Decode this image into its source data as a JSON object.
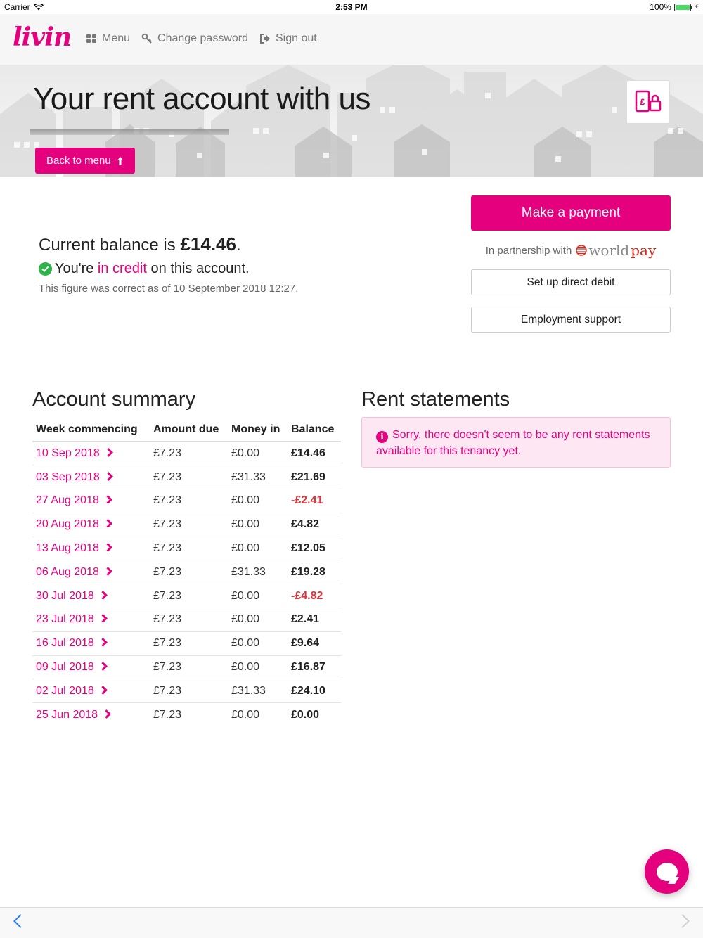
{
  "status_bar": {
    "carrier": "Carrier",
    "time": "2:53 PM",
    "battery": "100%"
  },
  "header": {
    "logo": "livin",
    "nav": [
      {
        "label": "Menu",
        "icon": "grid-icon"
      },
      {
        "label": "Change password",
        "icon": "key-icon"
      },
      {
        "label": "Sign out",
        "icon": "sign-out-icon"
      }
    ]
  },
  "hero": {
    "title": "Your rent account with us",
    "back_label": "Back to menu",
    "icon": "phone-payment-icon"
  },
  "balance": {
    "prefix": "Current balance is ",
    "amount": "£14.46",
    "suffix": ".",
    "status_prefix": "You're ",
    "status_highlight": "in credit",
    "status_suffix": " on this account.",
    "as_of": "This figure was correct as of 10 September 2018 12:27."
  },
  "actions": {
    "make_payment": "Make a payment",
    "partnership_text": "In partnership with",
    "partner_brand_1": "world",
    "partner_brand_2": "pay",
    "direct_debit": "Set up direct debit",
    "employment_support": "Employment support"
  },
  "account_summary": {
    "title": "Account summary",
    "columns": [
      "Week commencing",
      "Amount due",
      "Money in",
      "Balance"
    ],
    "rows": [
      {
        "week": "10 Sep 2018",
        "due": "£7.23",
        "in": "£0.00",
        "balance": "£14.46",
        "negative": false
      },
      {
        "week": "03 Sep 2018",
        "due": "£7.23",
        "in": "£31.33",
        "balance": "£21.69",
        "negative": false
      },
      {
        "week": "27 Aug 2018",
        "due": "£7.23",
        "in": "£0.00",
        "balance": "-£2.41",
        "negative": true
      },
      {
        "week": "20 Aug 2018",
        "due": "£7.23",
        "in": "£0.00",
        "balance": "£4.82",
        "negative": false
      },
      {
        "week": "13 Aug 2018",
        "due": "£7.23",
        "in": "£0.00",
        "balance": "£12.05",
        "negative": false
      },
      {
        "week": "06 Aug 2018",
        "due": "£7.23",
        "in": "£31.33",
        "balance": "£19.28",
        "negative": false
      },
      {
        "week": "30 Jul 2018",
        "due": "£7.23",
        "in": "£0.00",
        "balance": "-£4.82",
        "negative": true
      },
      {
        "week": "23 Jul 2018",
        "due": "£7.23",
        "in": "£0.00",
        "balance": "£2.41",
        "negative": false
      },
      {
        "week": "16 Jul 2018",
        "due": "£7.23",
        "in": "£0.00",
        "balance": "£9.64",
        "negative": false
      },
      {
        "week": "09 Jul 2018",
        "due": "£7.23",
        "in": "£0.00",
        "balance": "£16.87",
        "negative": false
      },
      {
        "week": "02 Jul 2018",
        "due": "£7.23",
        "in": "£31.33",
        "balance": "£24.10",
        "negative": false
      },
      {
        "week": "25 Jun 2018",
        "due": "£7.23",
        "in": "£0.00",
        "balance": "£0.00",
        "negative": false
      }
    ]
  },
  "rent_statements": {
    "title": "Rent statements",
    "message": "Sorry, there doesn't seem to be any rent statements available for this tenancy yet."
  },
  "colors": {
    "brand": "#e5007e",
    "negative": "#e0333a",
    "success": "#2eb34a"
  }
}
